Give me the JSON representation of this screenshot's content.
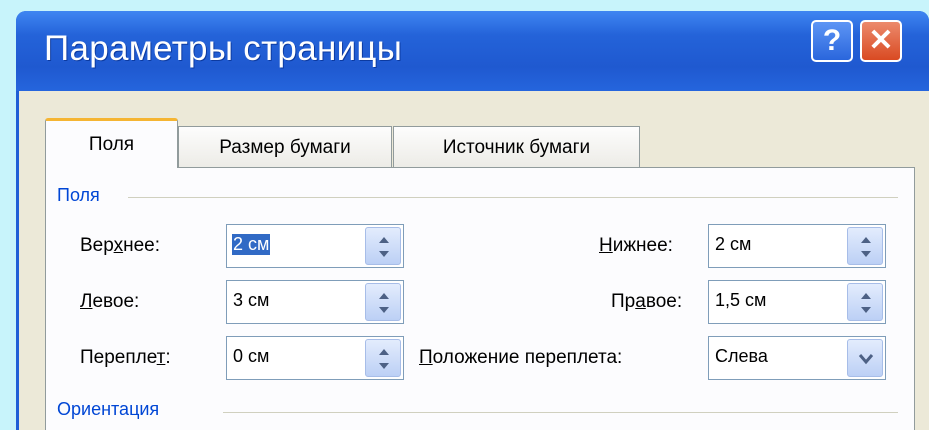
{
  "window": {
    "title": "Параметры страницы",
    "help_label": "?",
    "close_label": "✕"
  },
  "tabs": [
    {
      "label": "Поля",
      "active": true
    },
    {
      "label": "Размер бумаги",
      "active": false
    },
    {
      "label": "Источник бумаги",
      "active": false
    }
  ],
  "margins_group": {
    "label": "Поля",
    "top": {
      "label_pre": "Вер",
      "label_key": "х",
      "label_post": "нее:",
      "value": "2 см"
    },
    "bottom": {
      "label_pre": "",
      "label_key": "Н",
      "label_post": "ижнее:",
      "value": "2 см"
    },
    "left": {
      "label_pre": "",
      "label_key": "Л",
      "label_post": "евое:",
      "value": "3 см"
    },
    "right": {
      "label_pre": "Пр",
      "label_key": "а",
      "label_post": "вое:",
      "value": "1,5 см"
    },
    "gutter": {
      "label_pre": "Перепле",
      "label_key": "т",
      "label_post": ":",
      "value": "0 см"
    },
    "gutter_position": {
      "label_pre": "",
      "label_key": "П",
      "label_post": "оложение переплета:",
      "value": "Слева"
    }
  },
  "orientation_group": {
    "label": "Ориентация"
  },
  "colors": {
    "titlebar": "#2463d9",
    "active_tab_accent": "#f5b533",
    "group_label": "#0046d5",
    "selection": "#316ac5"
  },
  "icons": {
    "spin": "up-down-arrows-icon",
    "dropdown": "chevron-down-icon"
  }
}
